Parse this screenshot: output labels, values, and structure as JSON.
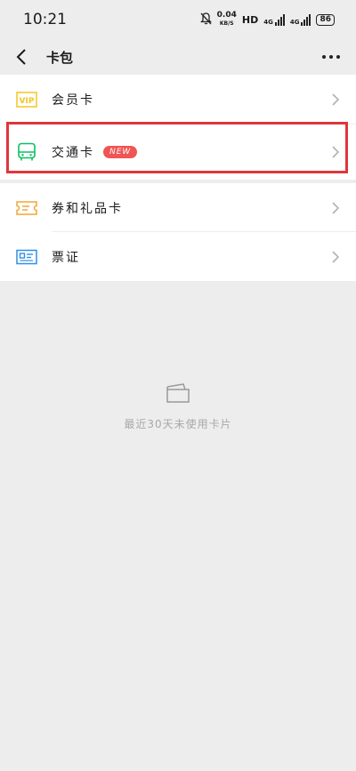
{
  "status": {
    "time": "10:21",
    "speed_value": "0.04",
    "speed_unit": "KB/S",
    "hd": "HD",
    "net1": "4G",
    "net2": "4G",
    "battery": "86"
  },
  "nav": {
    "title": "卡包"
  },
  "menu": [
    {
      "label": "会员卡",
      "icon": "vip-icon"
    },
    {
      "label": "交通卡",
      "icon": "bus-icon",
      "badge": "NEW"
    },
    {
      "label": "券和礼品卡",
      "icon": "ticket-icon"
    },
    {
      "label": "票证",
      "icon": "id-card-icon"
    }
  ],
  "empty": {
    "text": "最近30天未使用卡片"
  },
  "colors": {
    "vip": "#f3c623",
    "bus": "#07c160",
    "ticket": "#f2a532",
    "id": "#2f8fe6",
    "highlight": "#e0353c",
    "badge": "#f05454"
  }
}
